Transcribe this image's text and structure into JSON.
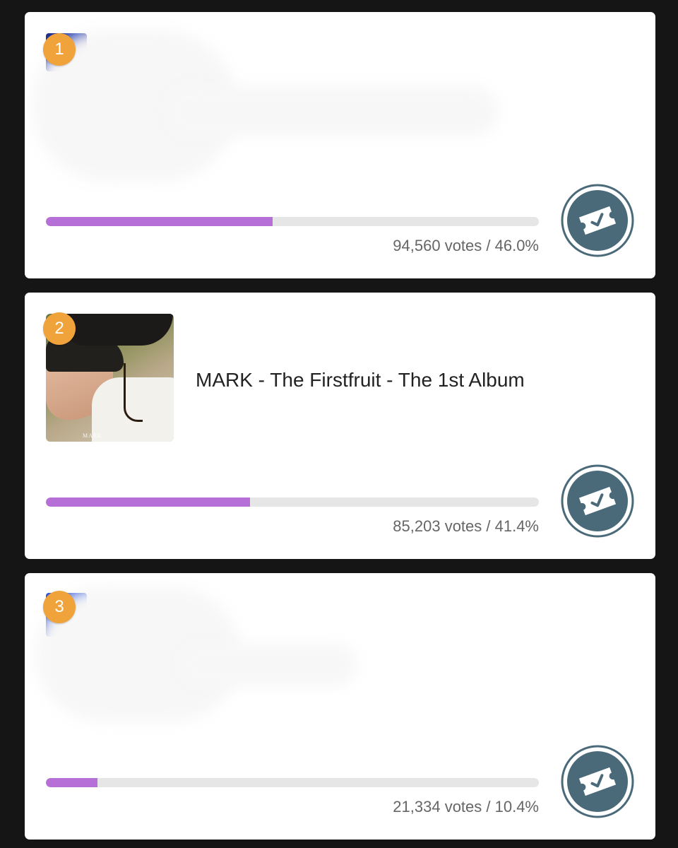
{
  "colors": {
    "page_background": "#151515",
    "card_background": "#ffffff",
    "rank_badge": "#f0a23b",
    "progress_fill": "#b56fd6",
    "progress_track": "#e6e6e6",
    "vote_icon": "#4a6a7a"
  },
  "entries": [
    {
      "rank": "1",
      "title": "",
      "votes_text": "94,560 votes / 46.0%",
      "progress_fraction": 0.46,
      "thumbnail_icon": "album-cover-thumbnail",
      "vote_button_icon": "ticket-check-icon"
    },
    {
      "rank": "2",
      "title": "MARK - The Firstfruit - The 1st Album",
      "thumbnail_caption": "MARK",
      "votes_text": "85,203 votes / 41.4%",
      "progress_fraction": 0.414,
      "thumbnail_icon": "album-cover-thumbnail",
      "vote_button_icon": "ticket-check-icon"
    },
    {
      "rank": "3",
      "title": "",
      "votes_text": "21,334 votes / 10.4%",
      "progress_fraction": 0.104,
      "thumbnail_icon": "album-cover-thumbnail",
      "vote_button_icon": "ticket-check-icon"
    }
  ]
}
